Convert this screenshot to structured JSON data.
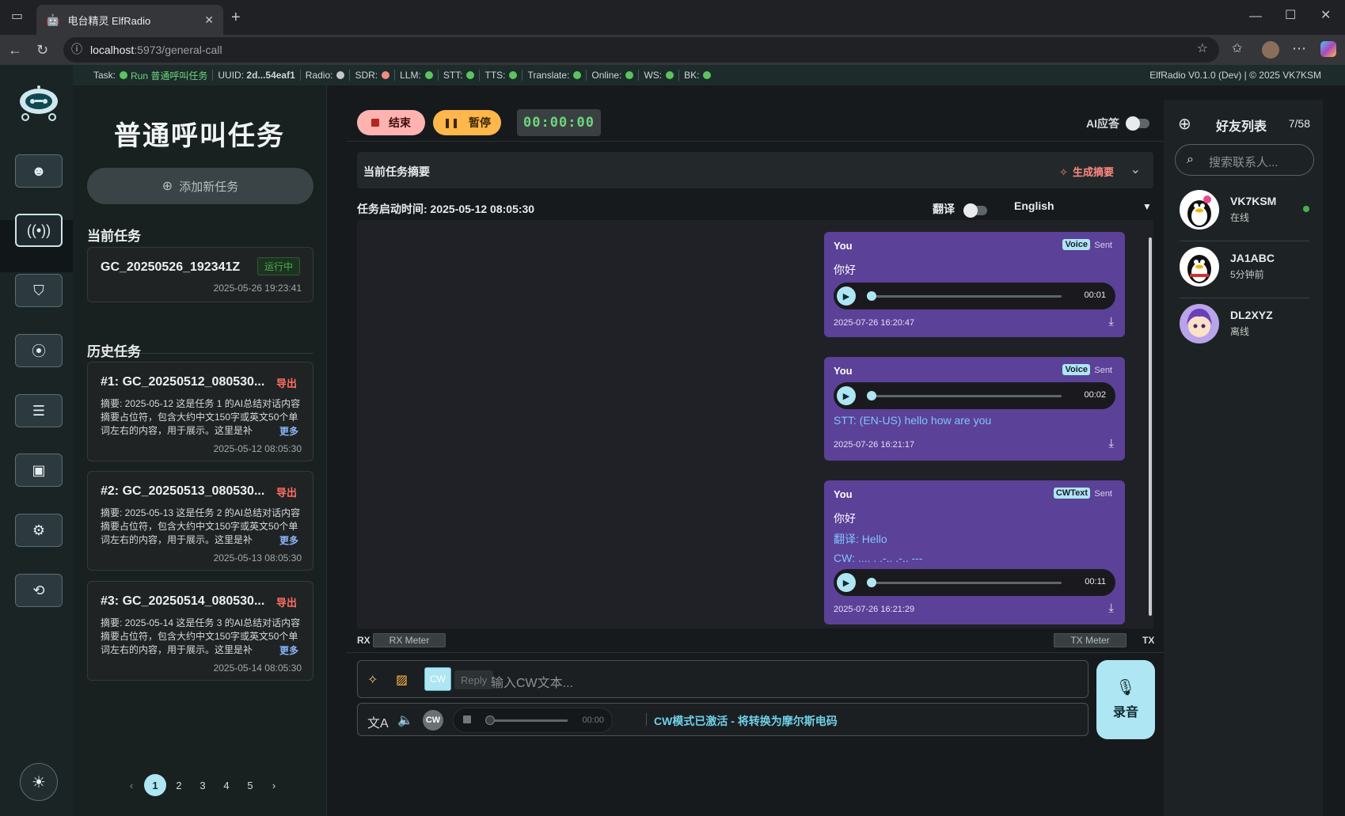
{
  "browser": {
    "tab_title": "电台精灵 ElfRadio",
    "url_host": "localhost",
    "url_path": ":5973/general-call"
  },
  "statusbar": {
    "task_label": "Task:",
    "task_value": "Run 普通呼叫任务",
    "uuid_label": "UUID:",
    "uuid_value": "2d...54eaf1",
    "indicators": [
      {
        "label": "Radio:",
        "color": "#c4c7c5"
      },
      {
        "label": "SDR:",
        "color": "#f28b82"
      },
      {
        "label": "LLM:",
        "color": "#5bc45e"
      },
      {
        "label": "STT:",
        "color": "#5bc45e"
      },
      {
        "label": "TTS:",
        "color": "#5bc45e"
      },
      {
        "label": "Translate:",
        "color": "#5bc45e"
      },
      {
        "label": "Online:",
        "color": "#5bc45e"
      },
      {
        "label": "WS:",
        "color": "#5bc45e"
      },
      {
        "label": "BK:",
        "color": "#5bc45e"
      }
    ],
    "version": "ElfRadio V0.1.0 (Dev) | © 2025 VK7KSM"
  },
  "tasks": {
    "title": "普通呼叫任务",
    "add_label": "添加新任务",
    "current_title": "当前任务",
    "current": {
      "name": "GC_20250526_192341Z",
      "status": "运行中",
      "date": "2025-05-26 19:23:41"
    },
    "history_title": "历史任务",
    "history": [
      {
        "name": "#1: GC_20250512_080530...",
        "export": "导出",
        "summary": "摘要: 2025-05-12 这是任务 1 的AI总结对话内容摘要占位符，包含大约中文150字或英文50个单词左右的内容，用于展示。这里是补",
        "more": "更多",
        "date": "2025-05-12 08:05:30"
      },
      {
        "name": "#2: GC_20250513_080530...",
        "export": "导出",
        "summary": "摘要: 2025-05-13 这是任务 2 的AI总结对话内容摘要占位符，包含大约中文150字或英文50个单词左右的内容，用于展示。这里是补",
        "more": "更多",
        "date": "2025-05-13 08:05:30"
      },
      {
        "name": "#3: GC_20250514_080530...",
        "export": "导出",
        "summary": "摘要: 2025-05-14 这是任务 3 的AI总结对话内容摘要占位符，包含大约中文150字或英文50个单词左右的内容，用于展示。这里是补",
        "more": "更多",
        "date": "2025-05-14 08:05:30"
      }
    ],
    "pages": [
      "1",
      "2",
      "3",
      "4",
      "5"
    ],
    "current_page": "1"
  },
  "main": {
    "end_label": "结束",
    "pause_label": "暂停",
    "timer": "00:00:00",
    "ai_reply_label": "AI应答",
    "summary_label": "当前任务摘要",
    "generate_label": "生成摘要",
    "start_time": "任务启动时间: 2025-05-12 08:05:30",
    "translate_label": "翻译",
    "language": "English",
    "messages": [
      {
        "who": "You",
        "badge": "Voice",
        "status": "Sent",
        "text": "你好",
        "duration": "00:01",
        "time": "2025-07-26 16:20:47"
      },
      {
        "who": "You",
        "badge": "Voice",
        "status": "Sent",
        "duration": "00:02",
        "stt": "STT: (EN-US) hello how are you",
        "time": "2025-07-26 16:21:17"
      },
      {
        "who": "You",
        "badge": "CWText",
        "status": "Sent",
        "text": "你好",
        "translation": "翻译: Hello",
        "cw": "CW: .... . .-.. .-.. ---",
        "duration": "00:11",
        "time": "2025-07-26 16:21:29"
      }
    ],
    "rx_label": "RX",
    "rx_meter": "RX Meter",
    "tx_meter": "TX Meter",
    "tx_label": "TX",
    "cw_toggle": "CW",
    "reply_chip": "Reply",
    "cw_placeholder": "输入CW文本...",
    "record_label": "录音",
    "cw_circle": "CW",
    "mini_duration": "00:00",
    "cw_status": "CW模式已激活 - 将转换为摩尔斯电码"
  },
  "friends": {
    "title": "好友列表",
    "count": "7/58",
    "search_placeholder": "搜索联系人...",
    "items": [
      {
        "name": "VK7KSM",
        "status": "在线",
        "online": true
      },
      {
        "name": "JA1ABC",
        "status": "5分钟前",
        "online": false
      },
      {
        "name": "DL2XYZ",
        "status": "离线",
        "online": false
      }
    ]
  }
}
